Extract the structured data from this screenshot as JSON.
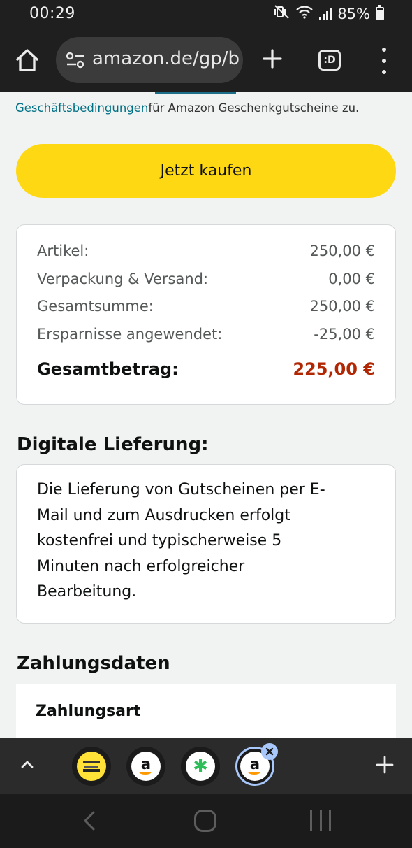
{
  "status_bar": {
    "time": "00:29",
    "battery": "85%",
    "icons": [
      "mute-vibrate-icon",
      "wifi-icon",
      "signal-icon",
      "battery-icon"
    ]
  },
  "browser": {
    "url": "amazon.de/gp/b",
    "tab_count": ":D",
    "icons": [
      "home-icon",
      "site-settings-icon",
      "plus-icon",
      "tab-switcher-icon",
      "more-vert-icon"
    ]
  },
  "page": {
    "terms_link": "Geschäftsbedingungen",
    "terms_text": "für Amazon Geschenkgutscheine zu.",
    "buy_button": "Jetzt kaufen",
    "summary": {
      "rows": [
        {
          "label": "Artikel:",
          "value": "250,00 €"
        },
        {
          "label": "Verpackung & Versand:",
          "value": "0,00 €"
        },
        {
          "label": "Gesamtsumme:",
          "value": "250,00 €"
        },
        {
          "label": "Ersparnisse angewendet:",
          "value": "-25,00 €"
        }
      ],
      "total_label": "Gesamtbetrag:",
      "total_value": "225,00 €"
    },
    "delivery_heading": "Digitale Lieferung:",
    "delivery_lines": [
      "Die Lieferung von Gutscheinen per E-",
      "Mail und zum Ausdrucken erfolgt",
      "kostenfrei und typischerweise 5",
      "Minuten nach erfolgreicher",
      "Bearbeitung."
    ],
    "payment_heading": "Zahlungsdaten",
    "payment_label": "Zahlungsart"
  },
  "tab_strip": {
    "tabs": [
      {
        "name": "tab-1",
        "icon": "yellow-site-icon"
      },
      {
        "name": "tab-2",
        "icon": "amazon-icon",
        "letter": "a"
      },
      {
        "name": "tab-3",
        "icon": "green-clover-icon",
        "glyph": "✱"
      },
      {
        "name": "tab-4",
        "icon": "amazon-icon",
        "letter": "a",
        "active": true
      }
    ],
    "colors": {
      "active_ring": "#a8c7fa",
      "amazon_orange": "#ff9900",
      "clover_green": "#2ebd59"
    }
  },
  "colors": {
    "buy_button": "#ffd814",
    "total_price": "#b12704",
    "link": "#007185",
    "page_bg": "#f1f2f2"
  }
}
